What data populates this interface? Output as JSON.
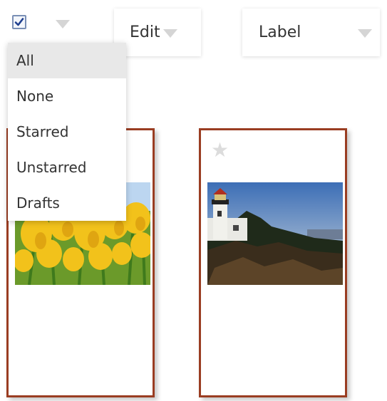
{
  "toolbar": {
    "select_all_checked": true,
    "edit_label": "Edit",
    "label_label": "Label"
  },
  "select_menu": {
    "items": [
      "All",
      "None",
      "Starred",
      "Unstarred",
      "Drafts"
    ],
    "highlighted": "All"
  },
  "colors": {
    "card_border": "#9a3d22",
    "caret": "#d5d5d5",
    "star_inactive": "#dcdcdc"
  },
  "cards": [
    {
      "thumbnail": "yellow-tulips-photo",
      "starred": false
    },
    {
      "thumbnail": "lighthouse-on-cliff-photo",
      "starred": false
    }
  ]
}
